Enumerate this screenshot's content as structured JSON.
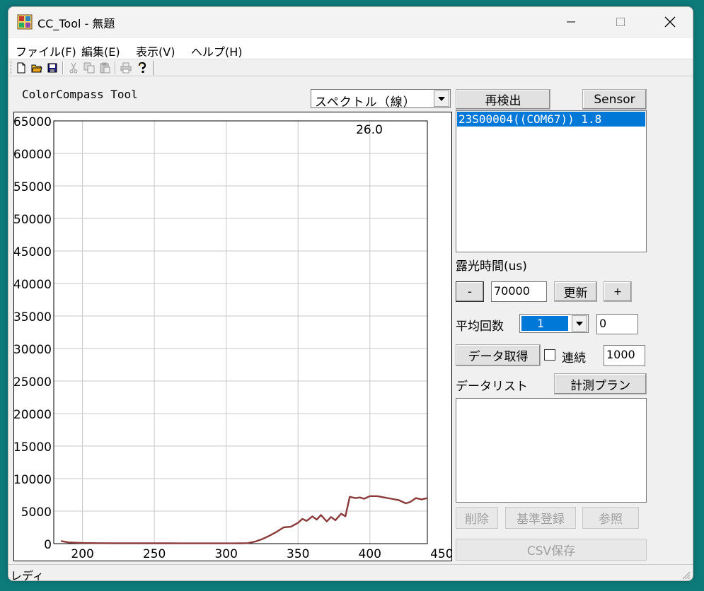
{
  "window": {
    "title": "CC_Tool - 無題"
  },
  "menu": {
    "items": [
      "ファイル(F)",
      "編集(E)",
      "表示(V)",
      "ヘルプ(H)"
    ]
  },
  "toolbar": {
    "icons": [
      "new-file-icon",
      "open-folder-icon",
      "save-icon",
      "cut-icon",
      "copy-icon",
      "paste-icon",
      "print-icon",
      "help-icon"
    ]
  },
  "main": {
    "tool_label": "ColorCompass Tool",
    "view_select": "スペクトル（線）",
    "redetect_button": "再検出",
    "sensor_button": "Sensor",
    "sensors": [
      "23S00004((COM67)) 1.8"
    ],
    "exposure_label": "露光時間(us)",
    "minus_button": "-",
    "exposure_value": "70000",
    "update_button": "更新",
    "plus_button": "+",
    "average_label": "平均回数",
    "average_value": "1",
    "average_extra": "0",
    "acquire_button": "データ取得",
    "continuous_label": "連続",
    "continuous_value": "1000",
    "datalist_label": "データリスト",
    "plan_button": "計測プラン",
    "delete_button": "削除",
    "reference_button": "基準登録",
    "browse_button": "参照",
    "csv_button": "CSV保存"
  },
  "status": {
    "text": "レディ"
  },
  "colors": {
    "accent": "#0078d7",
    "line": "#8b3a3a",
    "background": "#f0f0f0",
    "desktop": "#0e7b7b"
  },
  "chart_data": {
    "type": "line",
    "annotation": "26.0",
    "xlim": [
      180,
      440
    ],
    "ylim": [
      0,
      65000
    ],
    "x_ticks": [
      200,
      250,
      300,
      350,
      400,
      450
    ],
    "y_ticks": [
      0,
      5000,
      10000,
      15000,
      20000,
      25000,
      30000,
      35000,
      40000,
      45000,
      50000,
      55000,
      60000,
      65000
    ],
    "grid": true,
    "series": [
      {
        "x": [
          185,
          190,
          200,
          210,
          220,
          230,
          240,
          250,
          260,
          270,
          280,
          290,
          300,
          305,
          310,
          315,
          320,
          325,
          330,
          335,
          340,
          345,
          350,
          353,
          356,
          360,
          363,
          366,
          370,
          373,
          376,
          380,
          383,
          386,
          390,
          393,
          396,
          400,
          405,
          410,
          415,
          420,
          425,
          428,
          432,
          436,
          440
        ],
        "y": [
          400,
          200,
          100,
          80,
          60,
          50,
          50,
          50,
          50,
          40,
          40,
          40,
          40,
          40,
          50,
          80,
          300,
          700,
          1200,
          1800,
          2500,
          2600,
          3200,
          3800,
          3500,
          4200,
          3700,
          4400,
          3400,
          4100,
          3600,
          4600,
          4200,
          7200,
          7000,
          7100,
          6900,
          7300,
          7300,
          7100,
          6900,
          6700,
          6200,
          6400,
          7000,
          6800,
          7000
        ]
      }
    ]
  }
}
